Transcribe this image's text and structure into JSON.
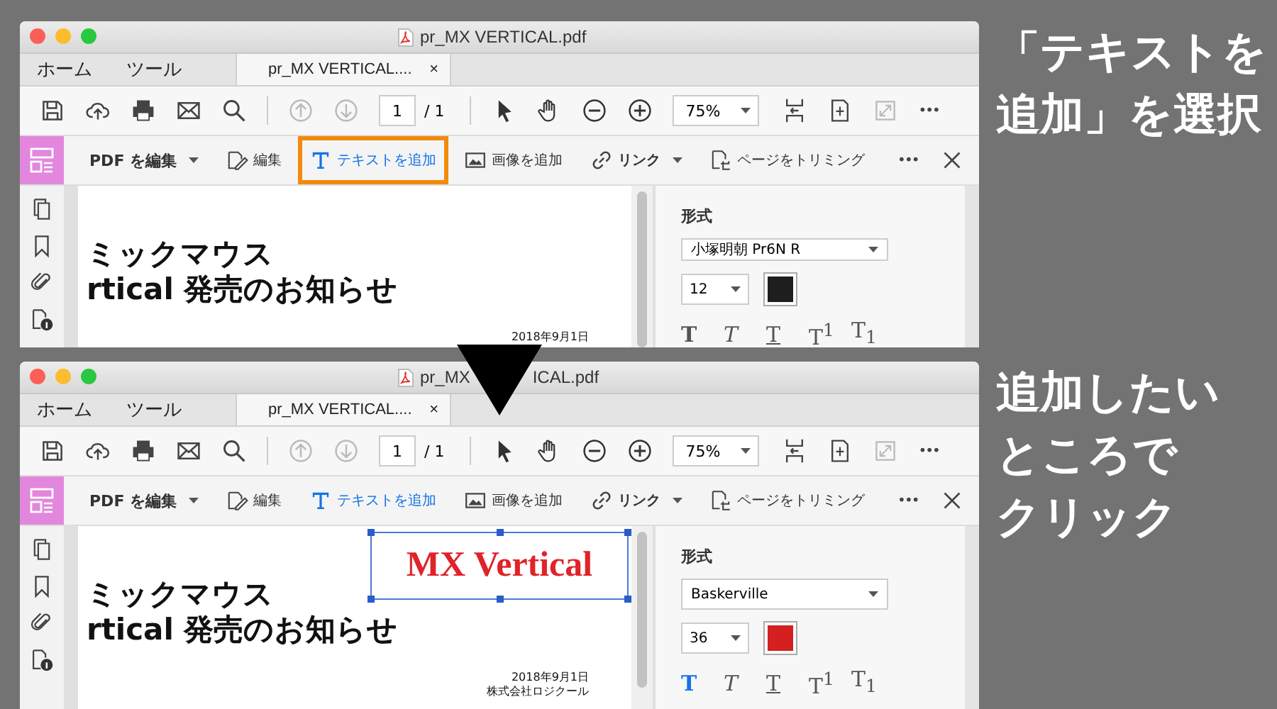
{
  "steps": [
    {
      "window": {
        "title": [
          "pr_MX VERTICAL.pdf"
        ],
        "tabs": [
          {
            "label": "ホーム",
            "selected": false
          },
          {
            "label": "ツール",
            "selected": false
          },
          {
            "label": "pr_MX VERTICAL....",
            "selected": true,
            "close": "×"
          }
        ],
        "toolbar": {
          "page": "1",
          "total": "/ 1",
          "zoom": "75%",
          "more": "•••"
        },
        "edit_bar": {
          "tools": [
            {
              "label": "PDF を編集",
              "kind": "menu",
              "active": false,
              "highlighted": false
            },
            {
              "label": "編集",
              "kind": "tool",
              "active": false,
              "highlighted": false
            },
            {
              "label": "テキストを追加",
              "kind": "tool",
              "active": true,
              "highlighted": true
            },
            {
              "label": "画像を追加",
              "kind": "tool",
              "active": false,
              "highlighted": false
            },
            {
              "label": "リンク",
              "kind": "menu",
              "active": false,
              "highlighted": false
            },
            {
              "label": "ページをトリミング",
              "kind": "tool",
              "active": false,
              "highlighted": false
            }
          ],
          "more": "•••"
        },
        "document": {
          "heading": [
            "ミックマウス",
            "rtical 発売のお知らせ"
          ],
          "dateline": [
            "2018年9月1日"
          ]
        },
        "format_panel": {
          "label": "形式",
          "font": "小塚明朝 Pr6N R",
          "size": "12",
          "color": "#1e1e1e",
          "styles": [
            {
              "label": "T",
              "kind": "bold",
              "selected": false
            },
            {
              "label": "T",
              "kind": "italic",
              "selected": false
            },
            {
              "label": "T",
              "kind": "underline",
              "selected": false
            },
            {
              "label": "T$^{1}$",
              "kind": "plain",
              "selected": false
            },
            {
              "label": "T$_{1}$",
              "kind": "plain",
              "selected": false
            }
          ]
        }
      },
      "caption": [
        "「テキストを",
        "追加」を選択"
      ]
    },
    {
      "window": {
        "title": [
          "pr_MX",
          "ICAL.pdf"
        ],
        "tabs": [
          {
            "label": "ホーム",
            "selected": false
          },
          {
            "label": "ツール",
            "selected": false
          },
          {
            "label": "pr_MX VERTICAL....",
            "selected": true,
            "close": "×"
          }
        ],
        "toolbar": {
          "page": "1",
          "total": "/ 1",
          "zoom": "75%",
          "more": "•••"
        },
        "edit_bar": {
          "tools": [
            {
              "label": "PDF を編集",
              "kind": "menu",
              "active": false,
              "highlighted": false
            },
            {
              "label": "編集",
              "kind": "tool",
              "active": false,
              "highlighted": false
            },
            {
              "label": "テキストを追加",
              "kind": "tool",
              "active": true,
              "highlighted": false
            },
            {
              "label": "画像を追加",
              "kind": "tool",
              "active": false,
              "highlighted": false
            },
            {
              "label": "リンク",
              "kind": "menu",
              "active": false,
              "highlighted": false
            },
            {
              "label": "ページをトリミング",
              "kind": "tool",
              "active": false,
              "highlighted": false
            }
          ],
          "more": "•••"
        },
        "document": {
          "heading": [
            "ミックマウス",
            "rtical 発売のお知らせ"
          ],
          "dateline": [
            "2018年9月1日",
            "株式会社ロジクール"
          ],
          "text_box": "MX Vertical"
        },
        "format_panel": {
          "label": "形式",
          "font": "Baskerville",
          "size": "36",
          "color": "#d42020",
          "styles": [
            {
              "label": "T",
              "kind": "bold",
              "selected": true
            },
            {
              "label": "T",
              "kind": "italic",
              "selected": false
            },
            {
              "label": "T",
              "kind": "underline",
              "selected": false
            },
            {
              "label": "T$^{1}$",
              "kind": "plain",
              "selected": false
            },
            {
              "label": "T$_{1}$",
              "kind": "plain",
              "selected": false
            }
          ]
        }
      },
      "caption": [
        "追加したい",
        "ところで",
        "クリック"
      ]
    }
  ]
}
